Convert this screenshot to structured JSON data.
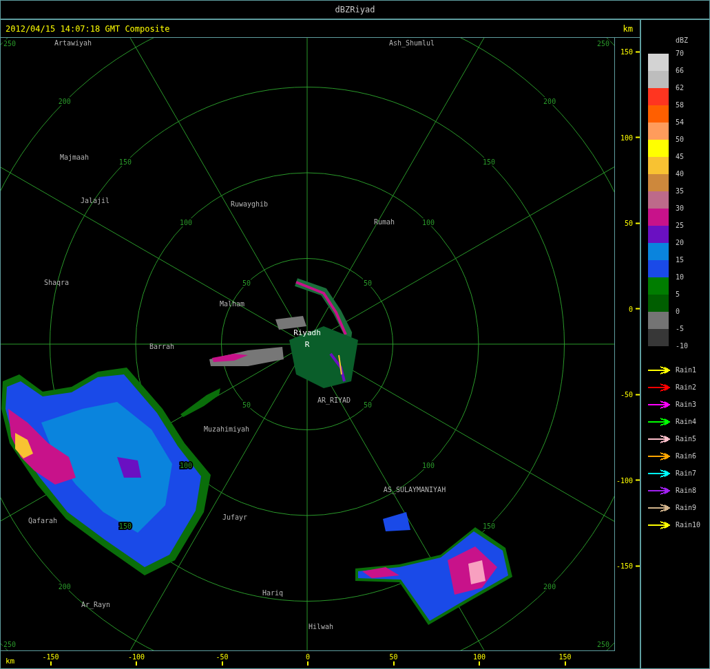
{
  "window": {
    "title": "dBZRiyad"
  },
  "header": {
    "timestamp": "2012/04/15 14:07:18 GMT Composite",
    "unit": "km"
  },
  "rings": [
    {
      "labels": [
        "50",
        "50",
        "50",
        "50"
      ]
    },
    {
      "labels": [
        "100",
        "100",
        "100",
        "100"
      ]
    },
    {
      "labels": [
        "150",
        "150",
        "150",
        "150"
      ]
    },
    {
      "labels": [
        "200",
        "200",
        "200",
        "200"
      ]
    },
    {
      "labels": [
        "250",
        "250",
        "250",
        "250"
      ]
    }
  ],
  "places": [
    {
      "name": "Artawiyah",
      "kind": "place"
    },
    {
      "name": "Ash_Shumlul",
      "kind": "place"
    },
    {
      "name": "Majmaah",
      "kind": "place"
    },
    {
      "name": "Jalajil",
      "kind": "place"
    },
    {
      "name": "Ruwayghib",
      "kind": "place"
    },
    {
      "name": "Rumah",
      "kind": "place"
    },
    {
      "name": "Shaqra",
      "kind": "place"
    },
    {
      "name": "Malham",
      "kind": "place"
    },
    {
      "name": "Riyadh",
      "kind": "radar"
    },
    {
      "name": "R",
      "kind": "radar"
    },
    {
      "name": "Barrah",
      "kind": "place"
    },
    {
      "name": "AR_RIYAD",
      "kind": "place"
    },
    {
      "name": "Muzahimiyah",
      "kind": "place"
    },
    {
      "name": "AS_SULAYMANIYAH",
      "kind": "place"
    },
    {
      "name": "Qafarah",
      "kind": "place"
    },
    {
      "name": "Jufayr",
      "kind": "place"
    },
    {
      "name": "Hariq",
      "kind": "place"
    },
    {
      "name": "Ar_Rayn",
      "kind": "place"
    },
    {
      "name": "Hilwah",
      "kind": "place"
    }
  ],
  "right_axis": {
    "ticks": [
      "150",
      "100",
      "50",
      "0",
      "-50",
      "-100",
      "-150"
    ]
  },
  "bottom_axis": {
    "unit": "km",
    "ticks": [
      "-150",
      "-100",
      "-50",
      "0",
      "50",
      "100",
      "150"
    ]
  },
  "color_scale": {
    "unit": "dBZ",
    "bins": [
      {
        "label": "70",
        "color": "#d3d3d3"
      },
      {
        "label": "66",
        "color": "#bdbdbd"
      },
      {
        "label": "62",
        "color": "#ff3520"
      },
      {
        "label": "58",
        "color": "#ff5f00"
      },
      {
        "label": "54",
        "color": "#ff9c5c"
      },
      {
        "label": "50",
        "color": "#ffff00"
      },
      {
        "label": "45",
        "color": "#f8c232"
      },
      {
        "label": "40",
        "color": "#cd883c"
      },
      {
        "label": "35",
        "color": "#bd6a8a"
      },
      {
        "label": "30",
        "color": "#c8128a"
      },
      {
        "label": "25",
        "color": "#6a10c2"
      },
      {
        "label": "20",
        "color": "#0a84dd"
      },
      {
        "label": "15",
        "color": "#1a4ae8"
      },
      {
        "label": "10",
        "color": "#007d00"
      },
      {
        "label": "5",
        "color": "#005e00"
      },
      {
        "label": "0",
        "color": "#747474"
      },
      {
        "label": "-5",
        "color": "#373737"
      }
    ],
    "bottom_label": "-10"
  },
  "rain": [
    {
      "label": "Rain1",
      "color": "#ffff00"
    },
    {
      "label": "Rain2",
      "color": "#ff0000"
    },
    {
      "label": "Rain3",
      "color": "#ff00ff"
    },
    {
      "label": "Rain4",
      "color": "#00ff00"
    },
    {
      "label": "Rain5",
      "color": "#ffc0cb"
    },
    {
      "label": "Rain6",
      "color": "#ffa500"
    },
    {
      "label": "Rain7",
      "color": "#00ffff"
    },
    {
      "label": "Rain8",
      "color": "#a020f0"
    },
    {
      "label": "Rain9",
      "color": "#d2b48c"
    },
    {
      "label": "Rain10",
      "color": "#ffff00"
    }
  ]
}
